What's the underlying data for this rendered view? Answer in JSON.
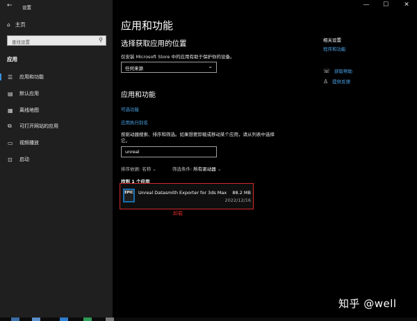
{
  "window": {
    "title": "设置",
    "back": "←",
    "minimize": "—",
    "maximize": "☐",
    "close": "✕"
  },
  "sidebar": {
    "home": "主页",
    "search_placeholder": "查找设置",
    "section": "应用",
    "items": [
      {
        "label": "应用和功能",
        "icon": "apps-list-icon"
      },
      {
        "label": "默认应用",
        "icon": "default-apps-icon"
      },
      {
        "label": "离线地图",
        "icon": "map-icon"
      },
      {
        "label": "可打开网站的应用",
        "icon": "open-web-icon"
      },
      {
        "label": "视频播放",
        "icon": "video-icon"
      },
      {
        "label": "启动",
        "icon": "startup-icon"
      }
    ]
  },
  "main": {
    "title": "应用和功能",
    "choose_heading": "选择获取应用的位置",
    "choose_desc": "仅安装 Microsoft Store 中的应用有助于保护你的设备。",
    "choose_value": "任何来源",
    "apps_heading": "应用和功能",
    "optional_features": "可选功能",
    "app_aliases": "应用执行别名",
    "search_desc": "按驱动器搜索、排序和筛选。如果想要卸载或移动某个应用，请从列表中选择它。",
    "search_value": "unreal",
    "sort_label": "排序依据:",
    "sort_value": "名称",
    "filter_label": "筛选条件:",
    "filter_value": "所有驱动器",
    "found": "找到 1 个应用",
    "app": {
      "name": "Unreal Datasmith Exporter for 3ds Max",
      "size": "88.2 MB",
      "date": "2022/12/16",
      "icon_text": "EPIC"
    },
    "uninstall_note": "卸载"
  },
  "related": {
    "heading": "相关设置",
    "link": "程序和功能",
    "help": "获取帮助",
    "feedback": "提供反馈"
  },
  "watermark": "知乎 @well",
  "colors": {
    "accent": "#4aa3e8",
    "highlight": "#d42a2a",
    "sidebar_bg": "#1f1f1f"
  }
}
